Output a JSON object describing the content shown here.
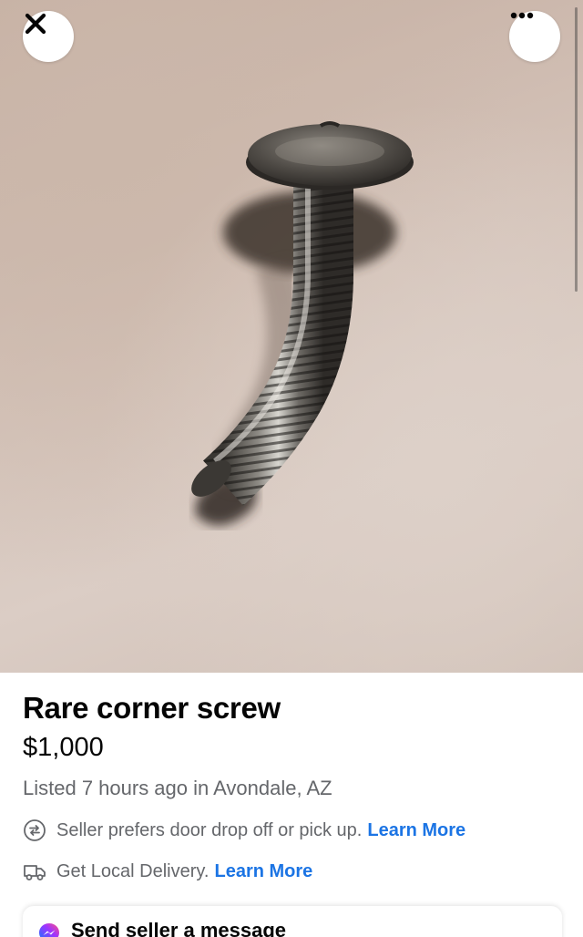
{
  "header": {
    "close_icon": "close-icon",
    "more_icon": "more-horizontal-icon"
  },
  "listing": {
    "title": "Rare corner screw",
    "price": "$1,000",
    "listed": "Listed 7 hours ago in Avondale, AZ",
    "preference": {
      "icon": "swap-arrows-icon",
      "text": "Seller prefers door drop off or pick up.",
      "link": "Learn More"
    },
    "delivery": {
      "icon": "delivery-truck-icon",
      "text": "Get Local Delivery.",
      "link": "Learn More"
    }
  },
  "message": {
    "icon": "messenger-icon",
    "label": "Send seller a message"
  },
  "colors": {
    "link": "#1b74e4",
    "secondary_text": "#65676b",
    "primary_text": "#050505"
  }
}
